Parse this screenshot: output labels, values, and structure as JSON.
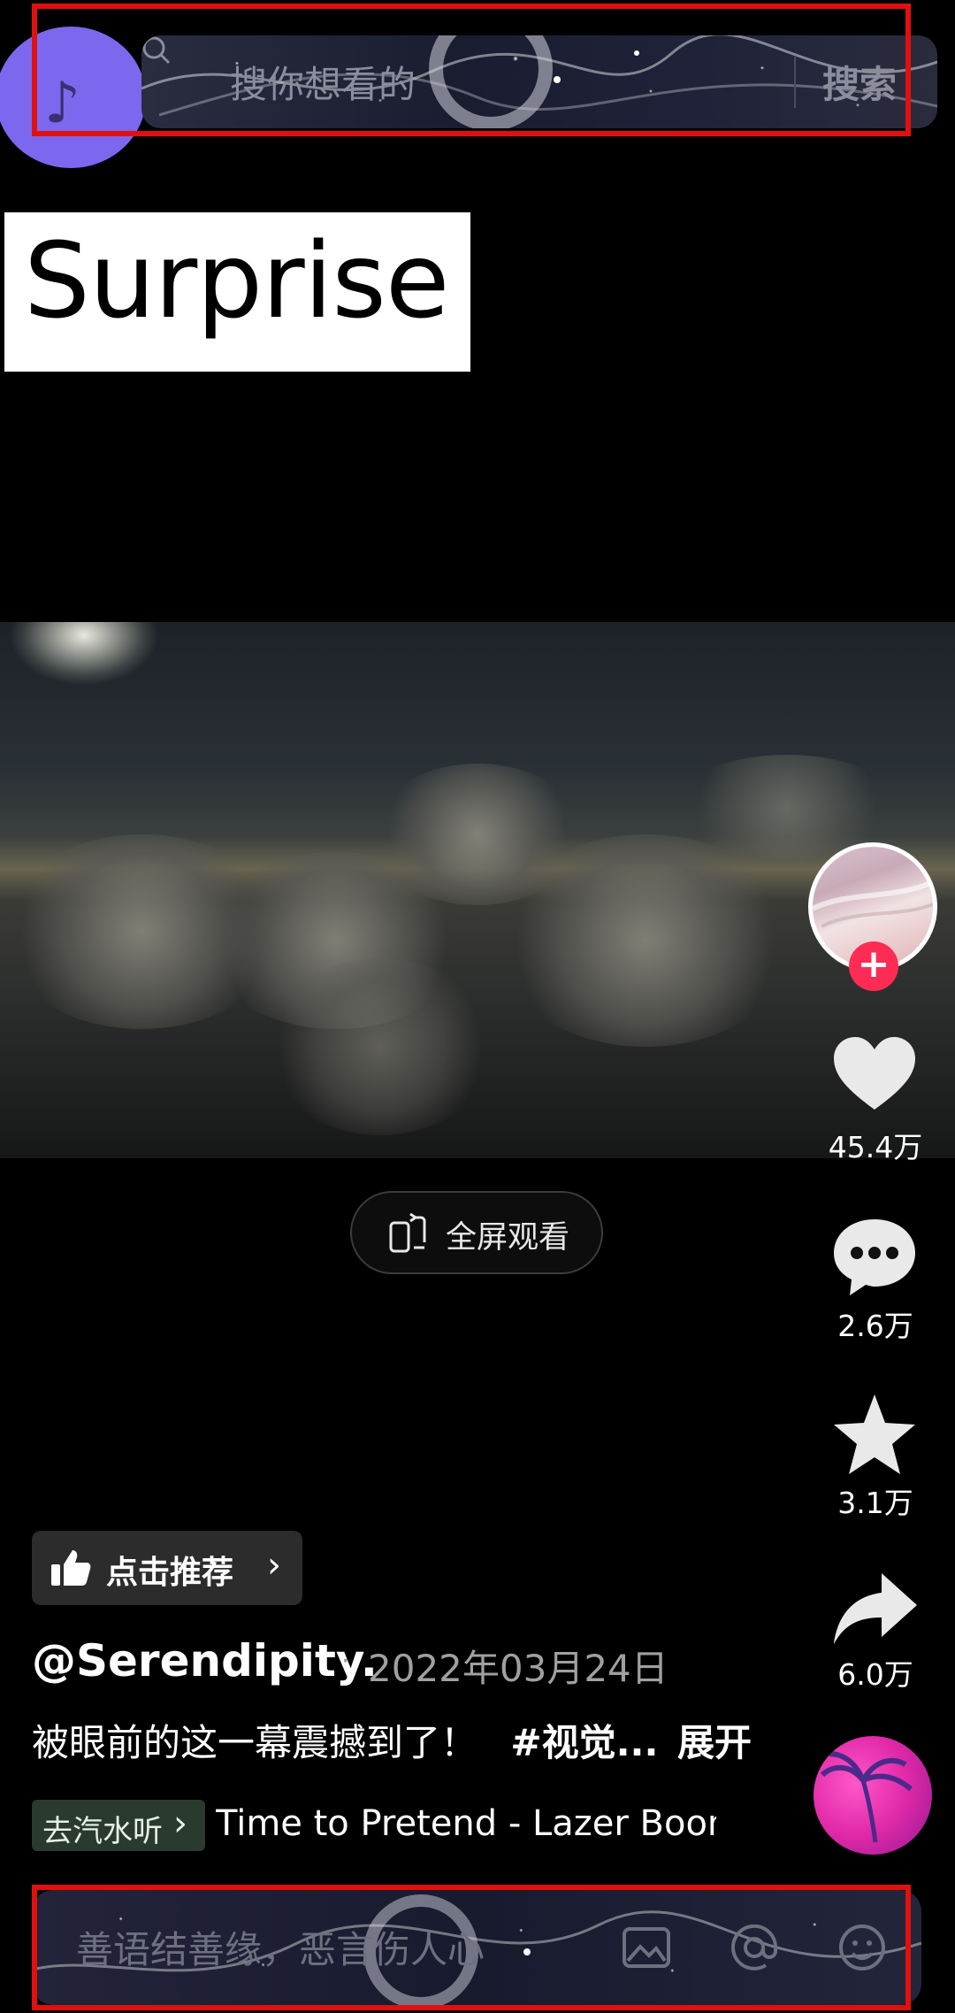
{
  "search": {
    "placeholder": "搜你想看的",
    "button_label": "搜索"
  },
  "video": {
    "overlay_title": "Surprise",
    "fullscreen_label": "全屏观看"
  },
  "rail": {
    "likes": "45.4万",
    "comments": "2.6万",
    "favorites": "3.1万",
    "shares": "6.0万"
  },
  "post": {
    "recommend_label": "点击推荐",
    "author": "@Serendipity.",
    "date": "2022年03月24日",
    "description": "被眼前的这一幕震撼到了！",
    "hashtag": "#视觉...",
    "expand_label": "展开",
    "listen_label": "去汽水听",
    "song": "Time to Pretend - Lazer Boom"
  },
  "comment": {
    "placeholder": "善语结善缘，恶言伤人心"
  },
  "colors": {
    "highlight_box": "#e01010",
    "follow": "#fe2c55",
    "accent_purple": "#7b68ee"
  }
}
